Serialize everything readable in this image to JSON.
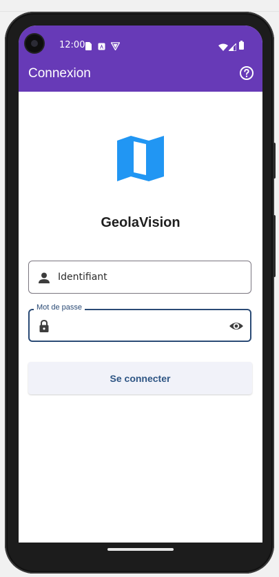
{
  "status_bar": {
    "time": "12:00"
  },
  "app_bar": {
    "title": "Connexion",
    "help_icon": "help-circle-outline"
  },
  "login": {
    "app_name": "GeolaVision",
    "logo_icon": "folded-map",
    "username_placeholder": "Identifiant",
    "username_value": "",
    "password_label": "Mot de passe",
    "password_value": "",
    "submit_label": "Se connecter"
  },
  "colors": {
    "app_bar": "#673AB7",
    "logo": "#2196F3",
    "focused_field": "#2a4a75",
    "button_bg": "#f1f2f9",
    "button_text": "#2e5584"
  }
}
